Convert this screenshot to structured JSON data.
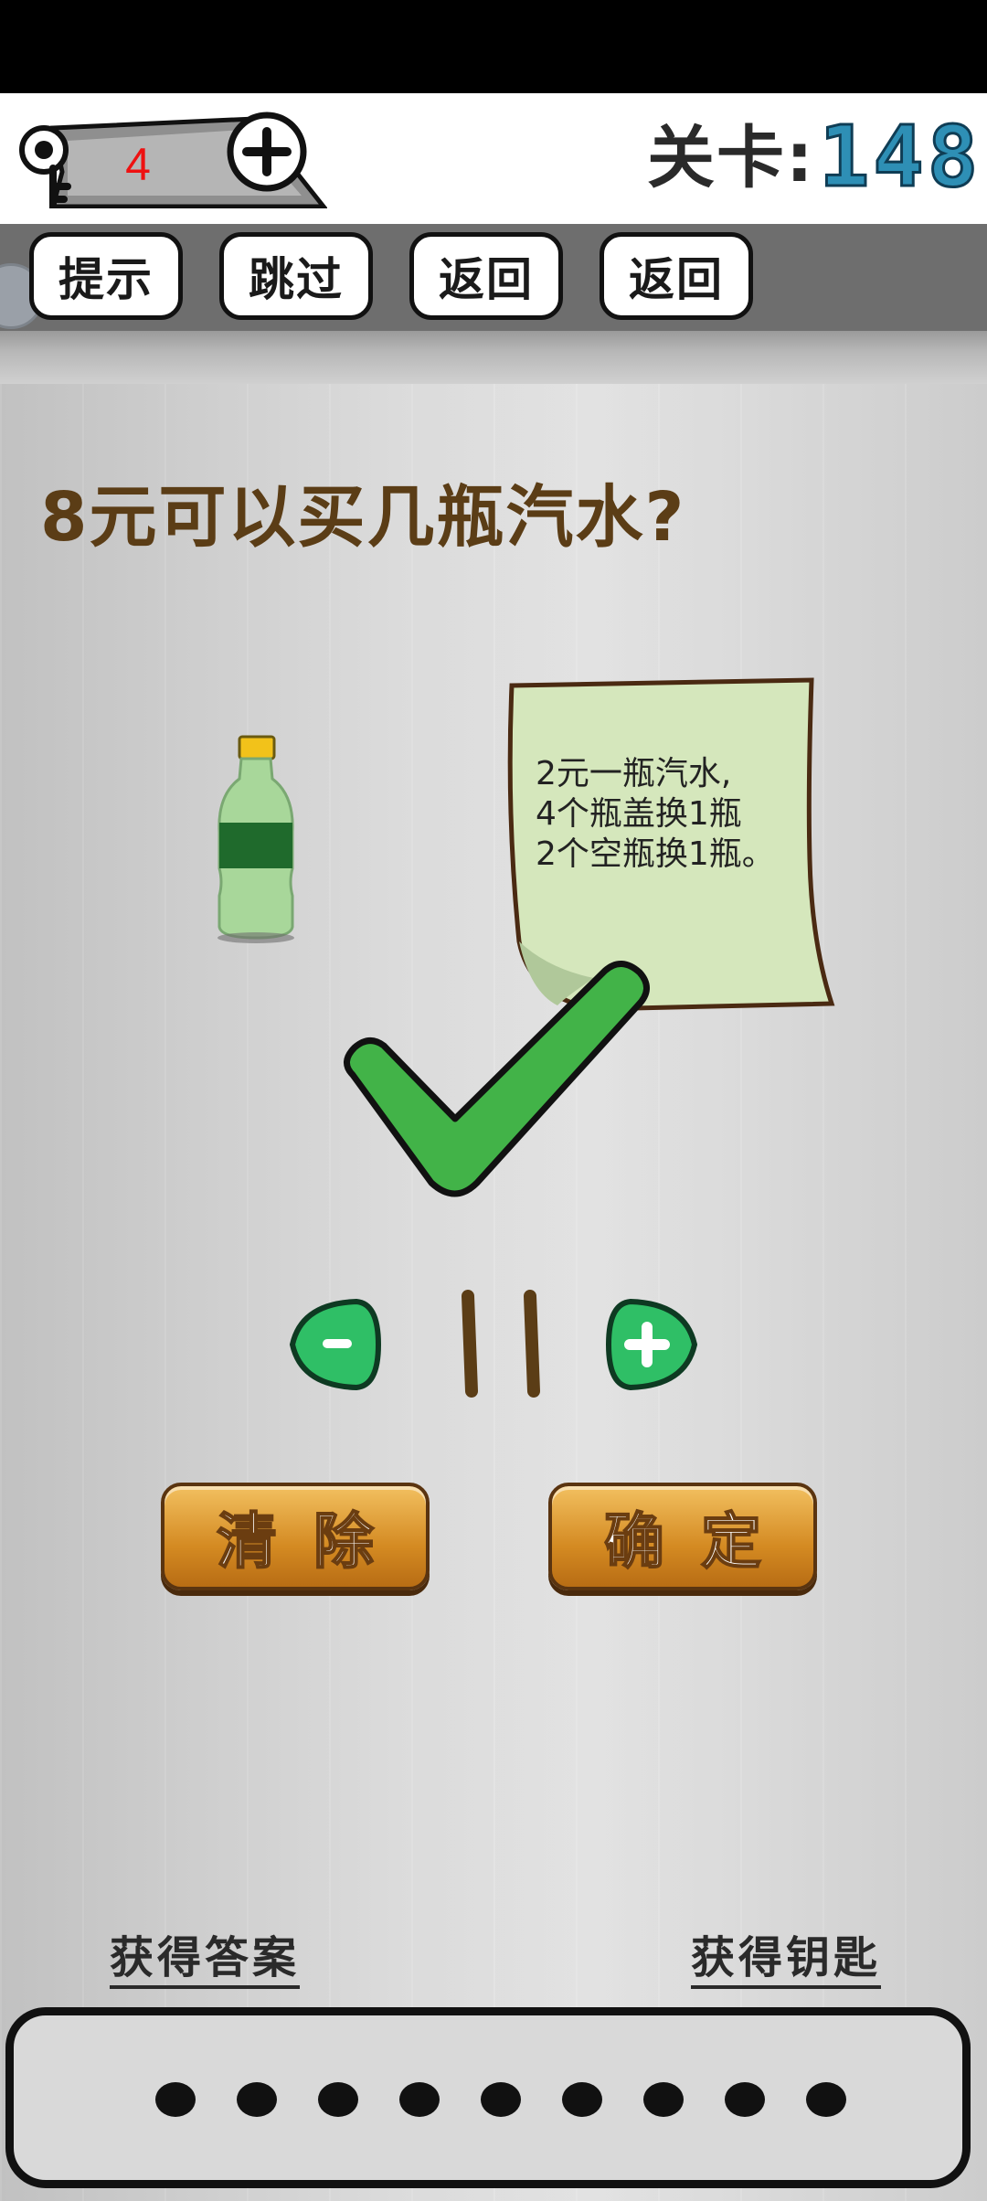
{
  "header": {
    "key_count": "4",
    "level_label": "关卡:",
    "level_number": "148"
  },
  "toolbar": {
    "hint_label": "提示",
    "skip_label": "跳过",
    "back_label_1": "返回",
    "back_label_2": "返回"
  },
  "puzzle": {
    "question": "8元可以买几瓶汽水?",
    "note_lines": [
      "2元一瓶汽水,",
      "4个瓶盖换1瓶",
      "2个空瓶换1瓶。"
    ],
    "answer_value": "11"
  },
  "actions": {
    "minus_label": "-",
    "plus_label": "+",
    "clear_label": "清除",
    "confirm_label": "确定"
  },
  "footer": {
    "get_answer_label": "获得答案",
    "get_key_label": "获得钥匙",
    "answer_slots": 9
  },
  "colors": {
    "level_number": "#2e8fb5",
    "check_green": "#3db34a",
    "question_brown": "#5b3d16",
    "key_number": "#ee1111"
  }
}
